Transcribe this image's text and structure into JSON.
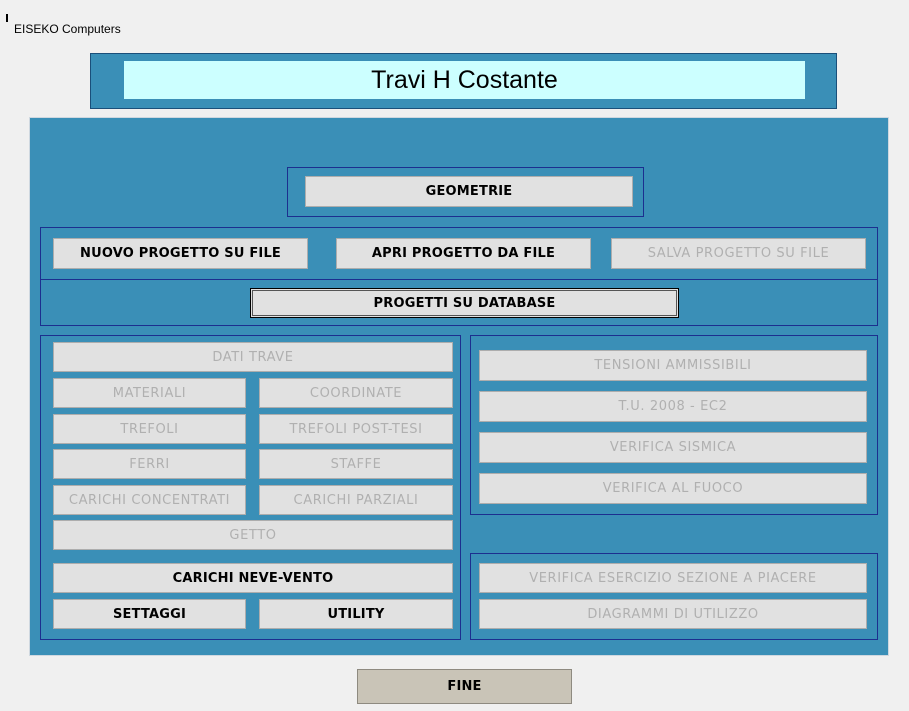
{
  "window": {
    "title": "EISEKO Computers"
  },
  "header": {
    "title": "Travi H Costante"
  },
  "buttons": {
    "geometrie": "GEOMETRIE",
    "nuovo_progetto": "NUOVO PROGETTO SU FILE",
    "apri_progetto": "APRI PROGETTO DA FILE",
    "salva_progetto": "SALVA PROGETTO SU FILE",
    "progetti_database": "PROGETTI SU DATABASE",
    "dati_trave": "DATI TRAVE",
    "materiali": "MATERIALI",
    "coordinate": "COORDINATE",
    "trefoli": "TREFOLI",
    "trefoli_post_tesi": "TREFOLI POST-TESI",
    "ferri": "FERRI",
    "staffe": "STAFFE",
    "carichi_concentrati": "CARICHI CONCENTRATI",
    "carichi_parziali": "CARICHI PARZIALI",
    "getto": "GETTO",
    "carichi_neve_vento": "CARICHI NEVE-VENTO",
    "settaggi": "SETTAGGI",
    "utility": "UTILITY",
    "tensioni_ammissibili": "TENSIONI AMMISSIBILI",
    "tu_2008_ec2": "T.U. 2008 - EC2",
    "verifica_sismica": "VERIFICA SISMICA",
    "verifica_fuoco": "VERIFICA AL FUOCO",
    "verifica_esercizio": "VERIFICA ESERCIZIO SEZIONE A PIACERE",
    "diagrammi_utilizzo": "DIAGRAMMI DI UTILIZZO",
    "fine": "FINE"
  },
  "colors": {
    "panel": "#3a8fb7",
    "title_bg": "#ccffff",
    "frame_border": "#1c2f8f",
    "button_bg": "#e1e1e1",
    "disabled_text": "#b0b0b0",
    "fine_bg": "#c9c4b7"
  }
}
